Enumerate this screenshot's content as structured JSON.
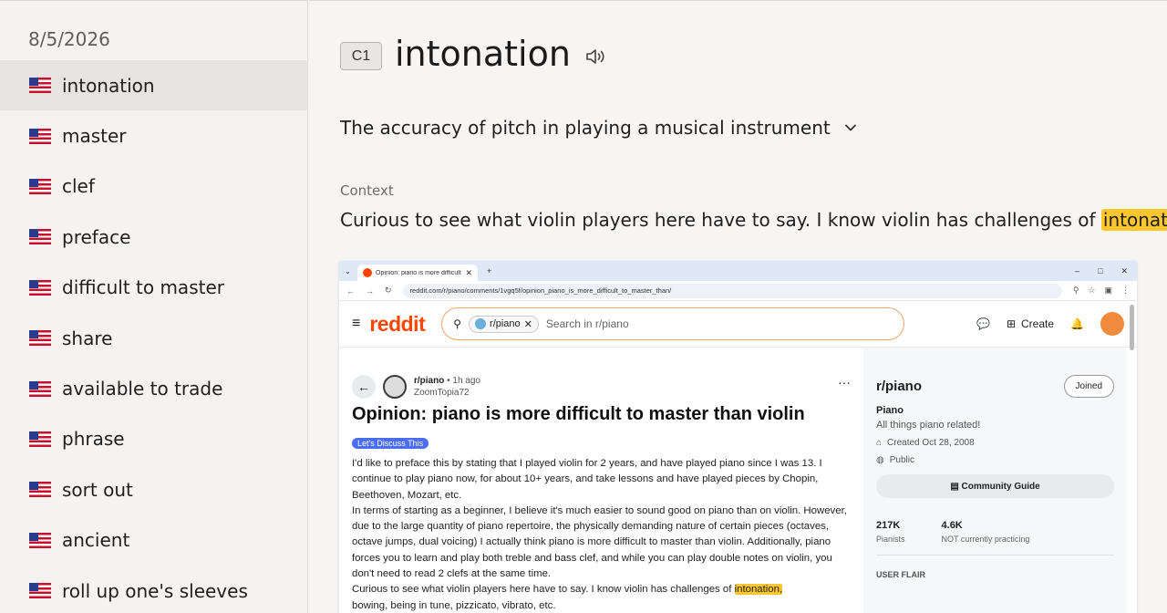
{
  "sidebar": {
    "date": "8/5/2026",
    "items": [
      {
        "label": "intonation"
      },
      {
        "label": "master"
      },
      {
        "label": "clef"
      },
      {
        "label": "preface"
      },
      {
        "label": "difficult to master"
      },
      {
        "label": "share"
      },
      {
        "label": "available to trade"
      },
      {
        "label": "phrase"
      },
      {
        "label": "sort out"
      },
      {
        "label": "ancient"
      },
      {
        "label": "roll up one's sleeves"
      }
    ]
  },
  "main": {
    "level": "C1",
    "word": "intonation",
    "definition": "The accuracy of pitch in playing a musical instrument",
    "context_label": "Context",
    "context_before": "Curious to see what violin players here have to say. I know violin has challenges of ",
    "context_highlight": "intonation",
    "context_after": ","
  },
  "screenshot": {
    "tab_title": "Opinion: piano is more difficult",
    "url": "reddit.com/r/piano/comments/1vgq5f/opinion_piano_is_more_difficult_to_master_than/",
    "logo": "reddit",
    "search_chip": "r/piano",
    "search_placeholder": "Search in r/piano",
    "create_label": "Create",
    "post": {
      "subreddit": "r/piano",
      "age": "• 1h ago",
      "author": "ZoomTopia72",
      "title": "Opinion: piano is more difficult to master than violin",
      "flair": "Let's Discuss This",
      "p1": "I'd like to preface this by stating that I played violin for 2 years, and have played piano since I was 13. I continue to play piano now, for about 10+ years, and take lessons and have played pieces by Chopin, Beethoven, Mozart, etc.",
      "p2": "In terms of starting as a beginner, I believe it's much easier to sound good on piano than on violin. However, due to the large quantity of piano repertoire, the physically demanding nature of certain pieces (octaves, octave jumps, dual voicing) I actually think piano is more difficult to master than violin. Additionally, piano forces you to learn and play both treble and bass clef, and while you can play double notes on violin, you don't need to read 2 clefs at the same time.",
      "p3_before": "Curious to see what violin players here have to say. I know violin has challenges of ",
      "p3_highlight": "intonation,",
      "p4": "bowing, being in tune, pizzicato, vibrato, etc."
    },
    "side": {
      "name": "r/piano",
      "joined": "Joined",
      "title": "Piano",
      "desc": "All things piano related!",
      "created": "Created Oct 28, 2008",
      "visibility": "Public",
      "guide": "Community Guide",
      "members_val": "217K",
      "members_lbl": "Pianists",
      "online_val": "4.6K",
      "online_lbl": "NOT currently practicing",
      "flair_head": "USER FLAIR"
    }
  }
}
